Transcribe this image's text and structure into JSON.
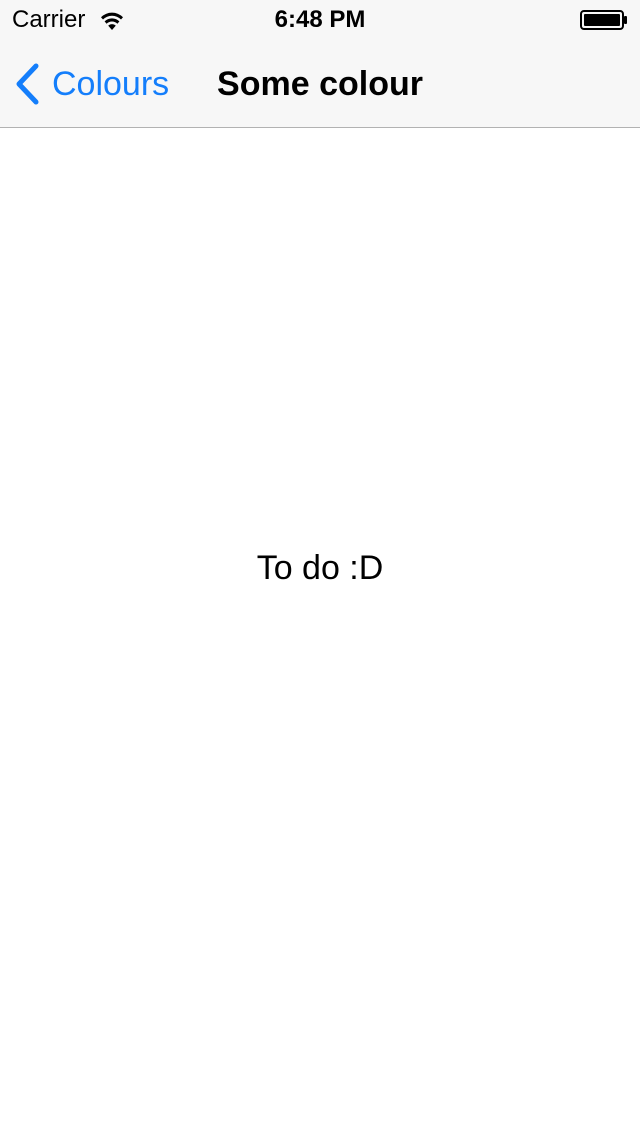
{
  "status_bar": {
    "carrier": "Carrier",
    "time": "6:48 PM",
    "wifi_icon": "wifi-icon",
    "battery_icon": "battery-icon"
  },
  "nav_bar": {
    "back_label": "Colours",
    "back_icon": "chevron-left-icon",
    "title": "Some colour"
  },
  "content": {
    "label": "To do :D"
  },
  "colors": {
    "accent": "#147efb",
    "nav_background": "#f7f7f7",
    "nav_border": "#b2b2b2",
    "background": "#ffffff"
  }
}
